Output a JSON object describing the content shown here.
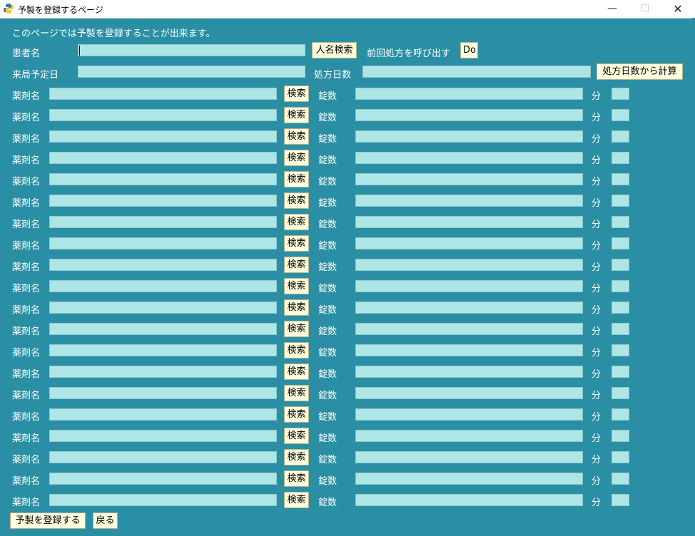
{
  "window": {
    "title": "予製を登録するページ",
    "minimize": "—",
    "maximize": "☐",
    "close": "✕"
  },
  "intro": "このページでは予製を登録することが出来ます。",
  "patient": {
    "label": "患者名",
    "value": "",
    "search_button": "人名検索"
  },
  "previous": {
    "label": "前回処方を呼び出す",
    "button": "Do"
  },
  "visit": {
    "label": "来局予定日",
    "value": ""
  },
  "days": {
    "label": "処方日数",
    "value": "",
    "calc_button": "処方日数から計算"
  },
  "drug_label": "薬剤名",
  "search_label": "検索",
  "count_label": "錠数",
  "unit_label": "分",
  "drug_rows": 20,
  "footer": {
    "register_button": "予製を登録する",
    "back_button": "戻る"
  }
}
